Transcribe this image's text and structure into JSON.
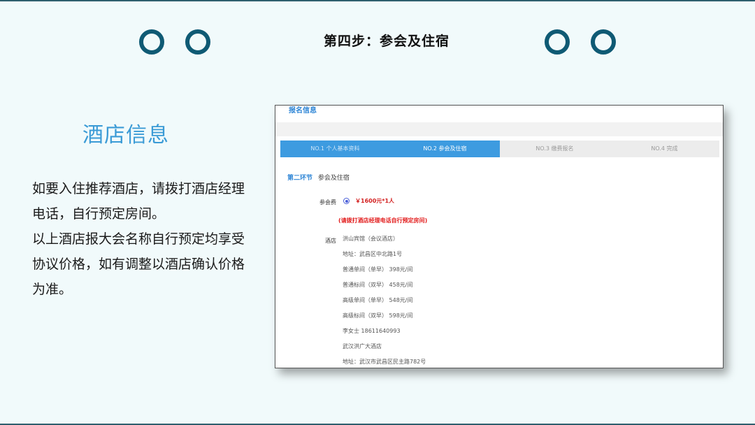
{
  "header": {
    "title": "第四步：参会及住宿"
  },
  "left": {
    "heading": "酒店信息",
    "paragraph1": "如要入住推荐酒店，请拨打酒店经理电话，自行预定房间。",
    "paragraph2": "以上酒店报大会名称自行预定均享受协议价格，如有调整以酒店确认价格为准。"
  },
  "screenshot": {
    "header_title": "报名信息",
    "steps": [
      {
        "label": "NO.1 个人基本资料",
        "state": "done"
      },
      {
        "label": "NO.2 参会及住宿",
        "state": "active"
      },
      {
        "label": "NO.3 缴费报名",
        "state": "todo"
      },
      {
        "label": "NO.4 完成",
        "state": "todo"
      }
    ],
    "section_number": "第二环节",
    "section_title": "参会及住宿",
    "fee_label": "参会费",
    "fee_value": "￥1600元*1人",
    "warning": "(请拨打酒店经理电话自行预定房间)",
    "hotel_label": "酒店",
    "hotel_lines": [
      "洪山宾馆（会议酒店）",
      "地址：武昌区中北路1号",
      "普通单间（单早） 398元/间",
      "普通标间（双早） 458元/间",
      "高级单间（单早） 548元/间",
      "高级标间（双早） 598元/间",
      "李女士 18611640993",
      "武汉洪广大酒店",
      "地址：武汉市武昌区民主路782号"
    ]
  },
  "colors": {
    "accent_blue": "#3b9bd6",
    "ring": "#0f5a74",
    "warning_red": "#e21b1b"
  }
}
